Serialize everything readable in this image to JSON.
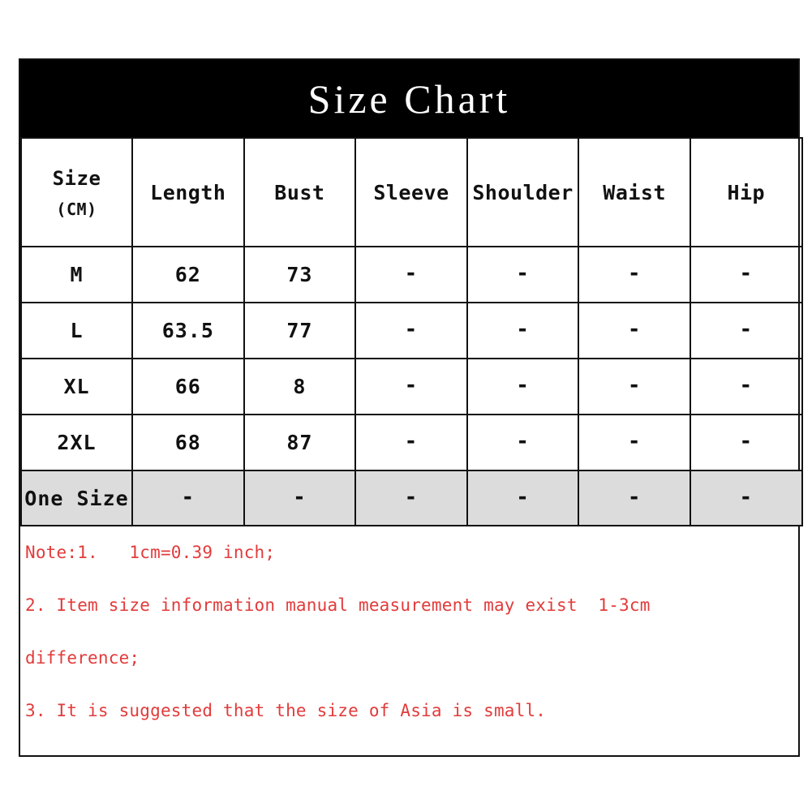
{
  "title": "Size Chart",
  "table": {
    "columns": [
      "Size",
      "Length",
      "Bust",
      "Sleeve",
      "Shoulder",
      "Waist",
      "Hip"
    ],
    "size_header": {
      "label": "Size",
      "unit": "(CM)"
    },
    "rows": [
      {
        "size": "M",
        "length": "62",
        "bust": "73",
        "sleeve": "-",
        "shoulder": "-",
        "waist": "-",
        "hip": "-"
      },
      {
        "size": "L",
        "length": "63.5",
        "bust": "77",
        "sleeve": "-",
        "shoulder": "-",
        "waist": "-",
        "hip": "-"
      },
      {
        "size": "XL",
        "length": "66",
        "bust": "8",
        "sleeve": "-",
        "shoulder": "-",
        "waist": "-",
        "hip": "-"
      },
      {
        "size": "2XL",
        "length": "68",
        "bust": "87",
        "sleeve": "-",
        "shoulder": "-",
        "waist": "-",
        "hip": "-"
      },
      {
        "size": "One Size",
        "length": "-",
        "bust": "-",
        "sleeve": "-",
        "shoulder": "-",
        "waist": "-",
        "hip": "-"
      }
    ]
  },
  "notes": [
    "Note:1.   1cm=0.39 inch;",
    "2. Item size information manual measurement may exist  1-3cm",
    "difference;",
    "3. It is suggested that the size of Asia is small."
  ],
  "colors": {
    "banner_background": "#000000",
    "banner_text": "#ffffff",
    "border": "#111111",
    "one_size_row_background": "#dcdcdc",
    "note_text": "#e23b3b",
    "page_background": "#ffffff"
  }
}
